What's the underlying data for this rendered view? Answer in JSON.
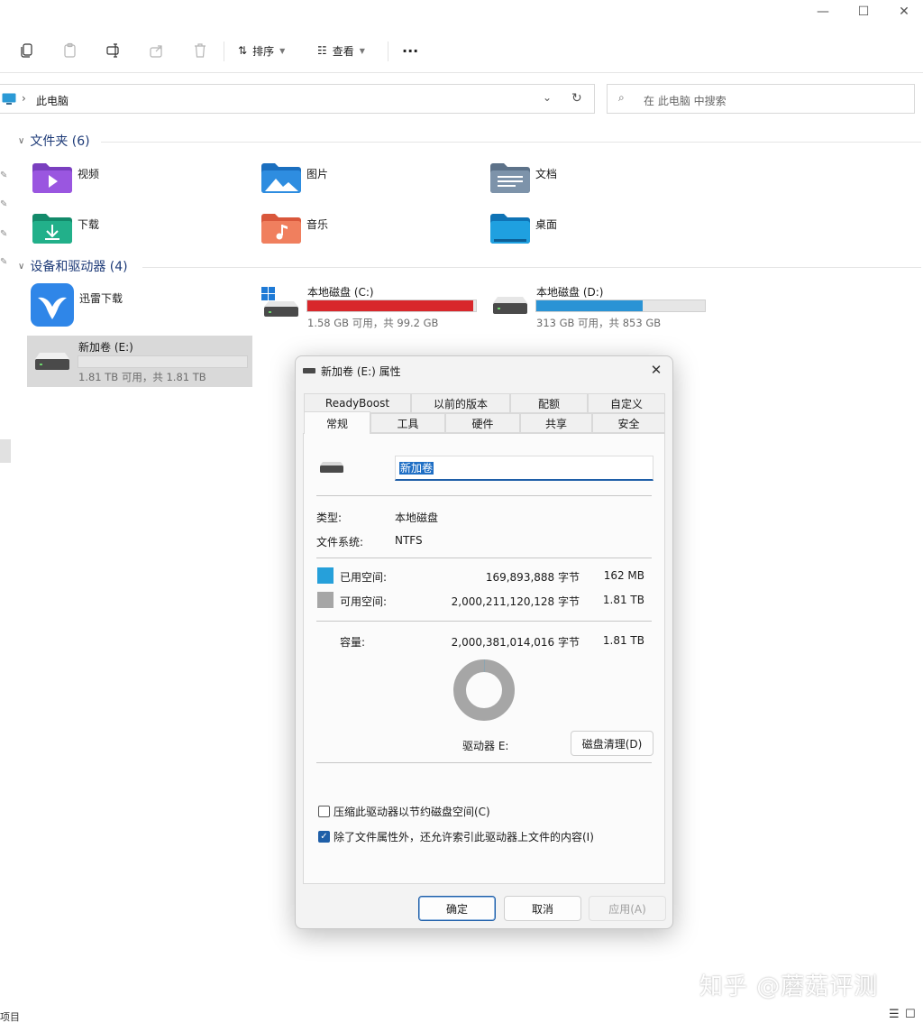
{
  "window": {
    "minimize_glyph": "—",
    "maximize_glyph": "☐",
    "close_glyph": "✕"
  },
  "toolbar": {
    "icons": [
      "copy-icon",
      "paste-icon",
      "rename-icon",
      "share-icon",
      "delete-icon"
    ],
    "sort_label": "排序",
    "view_label": "查看",
    "more_label": "···"
  },
  "address": {
    "current": "此电脑",
    "separator": "›"
  },
  "search": {
    "placeholder": "在 此电脑 中搜索"
  },
  "folders_section": {
    "title": "文件夹 (6)",
    "items": [
      {
        "label": "视频",
        "icon": "videos-folder-icon"
      },
      {
        "label": "图片",
        "icon": "pictures-folder-icon"
      },
      {
        "label": "文档",
        "icon": "documents-folder-icon"
      },
      {
        "label": "下载",
        "icon": "downloads-folder-icon"
      },
      {
        "label": "音乐",
        "icon": "music-folder-icon"
      },
      {
        "label": "桌面",
        "icon": "desktop-folder-icon"
      }
    ]
  },
  "devices_section": {
    "title": "设备和驱动器 (4)",
    "app": {
      "label": "迅雷下载"
    },
    "drives": [
      {
        "name": "本地磁盘 (C:)",
        "info": "1.58 GB 可用，共 99.2 GB",
        "used_fraction": 0.984,
        "color": "#d8272b"
      },
      {
        "name": "本地磁盘 (D:)",
        "info": "313 GB 可用，共 853 GB",
        "used_fraction": 0.633,
        "color": "#2a93d5"
      },
      {
        "name": "新加卷 (E:)",
        "info": "1.81 TB 可用，共 1.81 TB",
        "used_fraction": 0.0,
        "color": "#2a93d5"
      }
    ]
  },
  "dialog": {
    "title": "新加卷 (E:) 属性",
    "close_glyph": "✕",
    "tabs_row1": [
      "ReadyBoost",
      "以前的版本",
      "配额",
      "自定义"
    ],
    "tabs_row2": [
      "常规",
      "工具",
      "硬件",
      "共享",
      "安全"
    ],
    "active_tab": "常规",
    "volume_name": "新加卷",
    "type_label": "类型:",
    "type_value": "本地磁盘",
    "fs_label": "文件系统:",
    "fs_value": "NTFS",
    "used": {
      "label": "已用空间:",
      "bytes": "169,893,888 字节",
      "human": "162 MB",
      "color": "#26a0da"
    },
    "free": {
      "label": "可用空间:",
      "bytes": "2,000,211,120,128 字节",
      "human": "1.81 TB",
      "color": "#a6a6a6"
    },
    "capacity": {
      "label": "容量:",
      "bytes": "2,000,381,014,016 字节",
      "human": "1.81 TB"
    },
    "used_fraction": 0.0001,
    "drive_label": "驱动器 E:",
    "cleanup_button": "磁盘清理(D)",
    "compress_label": "压缩此驱动器以节约磁盘空间(C)",
    "compress_checked": false,
    "index_label": "除了文件属性外，还允许索引此驱动器上文件的内容(I)",
    "index_checked": true,
    "ok_button": "确定",
    "cancel_button": "取消",
    "apply_button": "应用(A)"
  },
  "status": {
    "items_text": "项目"
  },
  "watermark": "知乎 @蘑菇评测"
}
